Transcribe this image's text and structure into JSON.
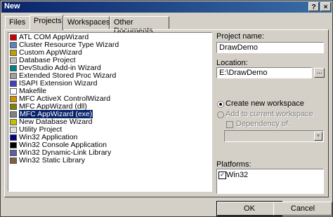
{
  "window": {
    "title": "New",
    "help_glyph": "?",
    "close_glyph": "×"
  },
  "tabs": [
    {
      "label": "Files",
      "active": false
    },
    {
      "label": "Projects",
      "active": true
    },
    {
      "label": "Workspaces",
      "active": false
    },
    {
      "label": "Other Documents",
      "active": false
    }
  ],
  "project_types": [
    {
      "label": "ATL COM AppWizard",
      "icon": "atl-icon"
    },
    {
      "label": "Cluster Resource Type Wizard",
      "icon": "cluster-icon"
    },
    {
      "label": "Custom AppWizard",
      "icon": "custom-wizard-icon"
    },
    {
      "label": "Database Project",
      "icon": "database-icon"
    },
    {
      "label": "DevStudio Add-in Wizard",
      "icon": "addin-icon"
    },
    {
      "label": "Extended Stored Proc Wizard",
      "icon": "stored-proc-icon"
    },
    {
      "label": "ISAPI Extension Wizard",
      "icon": "isapi-icon"
    },
    {
      "label": "Makefile",
      "icon": "makefile-icon"
    },
    {
      "label": "MFC ActiveX ControlWizard",
      "icon": "activex-icon"
    },
    {
      "label": "MFC AppWizard (dll)",
      "icon": "mfc-dll-icon"
    },
    {
      "label": "MFC AppWizard (exe)",
      "icon": "mfc-exe-icon",
      "selected": true
    },
    {
      "label": "New Database Wizard",
      "icon": "new-db-icon"
    },
    {
      "label": "Utility Project",
      "icon": "utility-icon"
    },
    {
      "label": "Win32 Application",
      "icon": "win32-app-icon"
    },
    {
      "label": "Win32 Console Application",
      "icon": "console-icon"
    },
    {
      "label": "Win32 Dynamic-Link Library",
      "icon": "dll-icon"
    },
    {
      "label": "Win32 Static Library",
      "icon": "static-lib-icon"
    }
  ],
  "project_name": {
    "label": "Project name:",
    "value": "DrawDemo"
  },
  "location": {
    "label": "Location:",
    "value": "E:\\DrawDemo",
    "browse_label": "..."
  },
  "workspace_options": {
    "create_new": "Create new workspace",
    "add_current": "Add to current workspace",
    "dependency": "Dependency of:"
  },
  "platforms": {
    "label": "Platforms:",
    "items": [
      "Win32"
    ]
  },
  "buttons": {
    "ok": "OK",
    "cancel": "Cancel"
  },
  "colors": {
    "title_bar": "#0a246a",
    "selection": "#0a246a",
    "face": "#d4d0c8"
  }
}
